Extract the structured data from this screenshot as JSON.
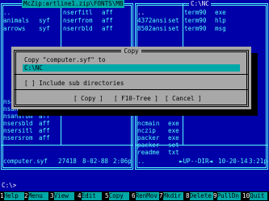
{
  "left_panel": {
    "title": "McZip:artline1.zip\\FONTS\\MB",
    "name_col_top": [
      {
        "name": "..",
        "ext": ""
      },
      {
        "name": "animals",
        "ext": "syf"
      },
      {
        "name": "arrows",
        "ext": "syf"
      }
    ],
    "name_col_bottom": [
      {
        "name": "nsansbld",
        "ext": "aff"
      },
      {
        "name": "nsansltl",
        "ext": "aff"
      },
      {
        "name": "nsansrom",
        "ext": "aff"
      },
      {
        "name": "nsersbld",
        "ext": "aff"
      },
      {
        "name": "nsersitl",
        "ext": "aff"
      },
      {
        "name": "nsersrom",
        "ext": "aff"
      }
    ],
    "right_col_top": [
      {
        "name": "nserfitl",
        "ext": "aff"
      },
      {
        "name": "nserfrom",
        "ext": "aff"
      },
      {
        "name": "nserrbld",
        "ext": "aff"
      }
    ],
    "status": {
      "name": "computer.syf",
      "size": "27418",
      "date": "8-02-88",
      "time": "2:06p"
    }
  },
  "right_panel": {
    "title": "C:\\NC",
    "left_col_top": [
      {
        "name": "..",
        "ext": ""
      },
      {
        "name": "4372ansi",
        "ext": "set"
      },
      {
        "name": "8502ansi",
        "ext": "set"
      }
    ],
    "right_col_top": [
      {
        "name": "term90",
        "ext": "exe"
      },
      {
        "name": "term90",
        "ext": "hlp"
      },
      {
        "name": "term90",
        "ext": "msg"
      }
    ],
    "left_col_bottom": [
      {
        "name": "ncmain",
        "ext": "exe"
      },
      {
        "name": "nczip",
        "ext": "exe"
      },
      {
        "name": "packer",
        "ext": "exe"
      },
      {
        "name": "packer",
        "ext": "set"
      },
      {
        "name": "readme",
        "ext": "txt"
      }
    ],
    "status": {
      "name": "..",
      "size": "►UP--DIR◄",
      "date": "10-20-14",
      "time": "3:21p"
    }
  },
  "dialog": {
    "title": "Copy",
    "prompt": "Copy \"computer.syf\" to",
    "target": "C:\\NC",
    "checkbox": "[ ] Include sub directories",
    "buttons": [
      "[ Copy ]",
      "[ F10-Tree ]",
      "[ Cancel ]"
    ]
  },
  "cmdline": "C:\\>",
  "keybar": [
    {
      "num": "1",
      "label": "Help"
    },
    {
      "num": "2",
      "label": "Menu"
    },
    {
      "num": "3",
      "label": "View"
    },
    {
      "num": "4",
      "label": "Edit"
    },
    {
      "num": "5",
      "label": "Copy"
    },
    {
      "num": "6",
      "label": "RenMov"
    },
    {
      "num": "7",
      "label": "Mkdir"
    },
    {
      "num": "8",
      "label": "Delete"
    },
    {
      "num": "9",
      "label": "PullDn"
    },
    {
      "num": "10",
      "label": "Quit"
    }
  ],
  "colors": {
    "panel_bg": "#0000a8",
    "frame": "#54fcfc",
    "highlight": "#00a8a8",
    "dialog_bg": "#a8a8a8"
  }
}
